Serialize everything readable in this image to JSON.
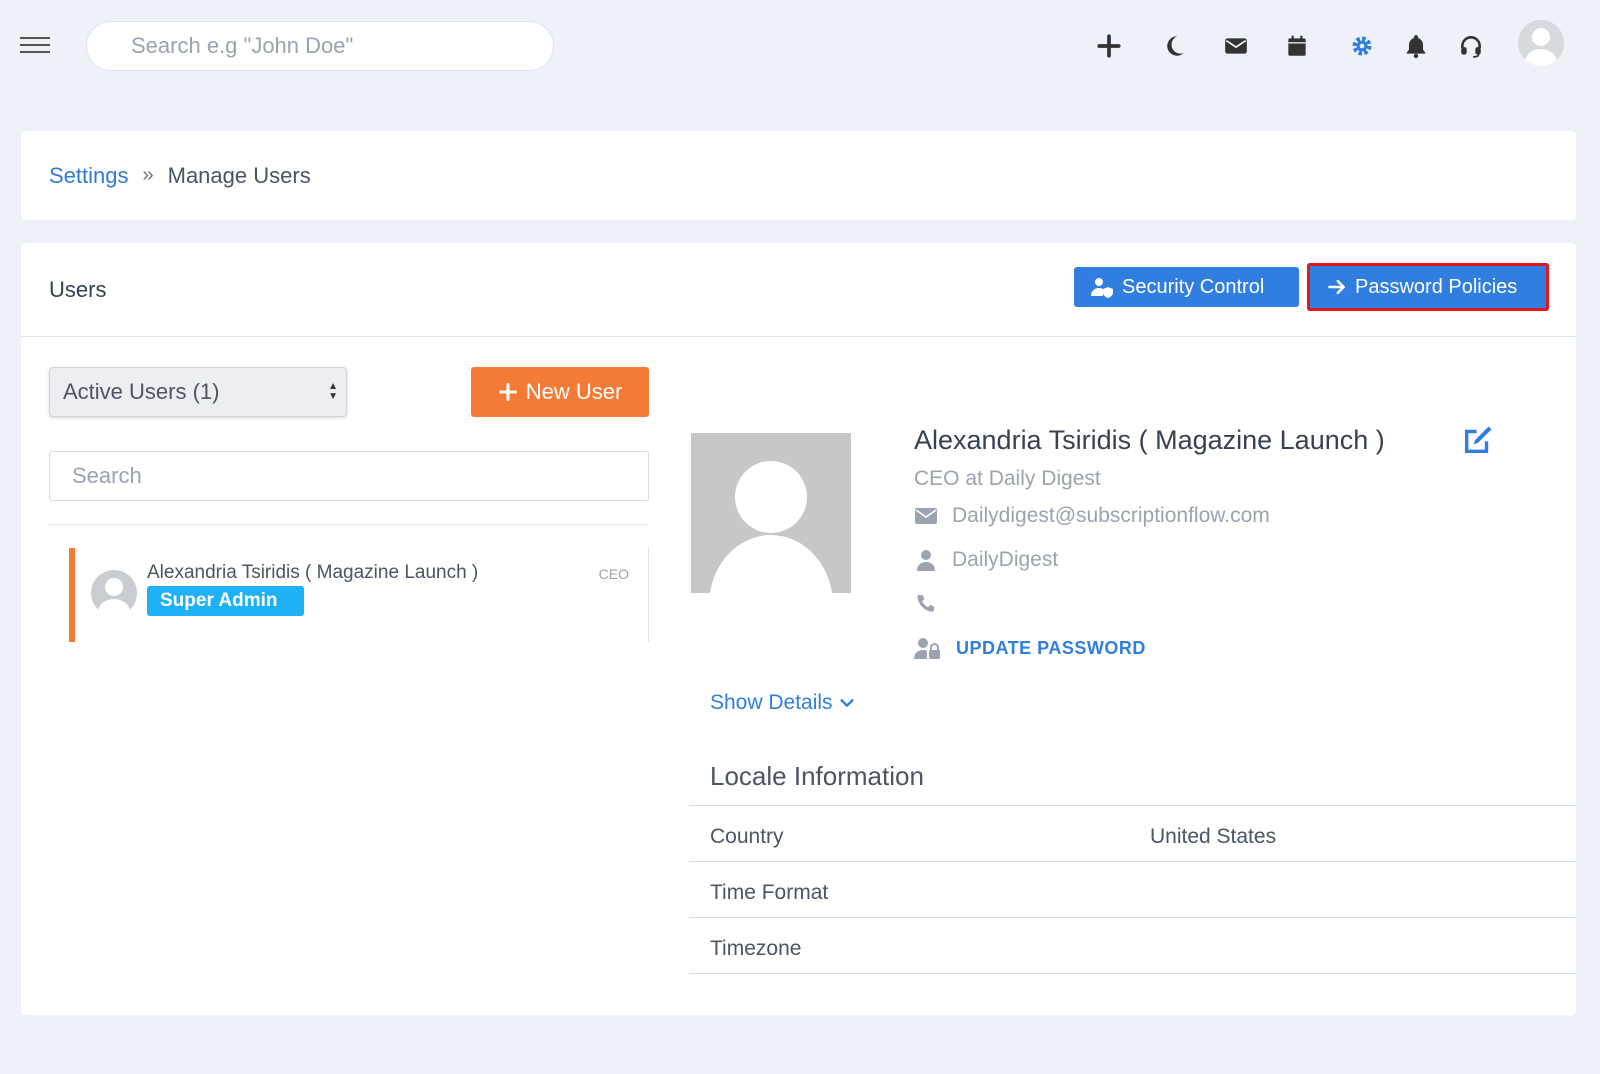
{
  "topbar": {
    "search_placeholder": "Search e.g \"John Doe\"",
    "icons": [
      "menu-icon",
      "plus-icon",
      "moon-icon",
      "mail-icon",
      "calendar-icon",
      "gear-icon",
      "bell-icon",
      "headset-icon",
      "avatar"
    ],
    "active_icon_color": "#2f7ee0"
  },
  "breadcrumb": {
    "parent": "Settings",
    "separator": "»",
    "current": "Manage Users"
  },
  "users_panel": {
    "title": "Users",
    "security_control_label": "Security Control",
    "password_policies_label": "Password Policies",
    "filter_value": "Active Users (1)",
    "new_user_label": "New User",
    "search_placeholder": "Search",
    "list": [
      {
        "name": "Alexandria Tsiridis ( Magazine Launch )",
        "role": "CEO",
        "badge": "Super Admin"
      }
    ]
  },
  "profile": {
    "name": "Alexandria Tsiridis ( Magazine Launch )",
    "title": "CEO at Daily Digest",
    "email": "Dailydigest@subscriptionflow.com",
    "username": "DailyDigest",
    "phone": "",
    "update_password_label": "UPDATE PASSWORD",
    "show_details_label": "Show Details"
  },
  "locale": {
    "title": "Locale Information",
    "rows": [
      {
        "label": "Country",
        "value": "United States"
      },
      {
        "label": "Time Format",
        "value": ""
      },
      {
        "label": "Timezone",
        "value": ""
      }
    ]
  },
  "colors": {
    "primary": "#2f7ee0",
    "orange": "#f47b36",
    "badge": "#1fb0f5",
    "highlight": "#e3181f"
  }
}
